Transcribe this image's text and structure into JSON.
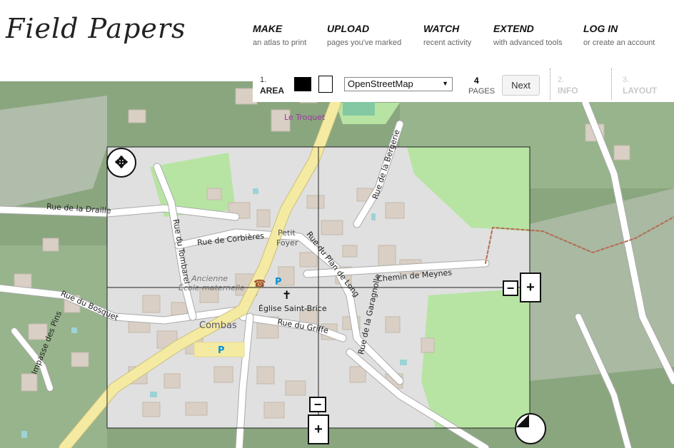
{
  "header": {
    "logo": "Field Papers",
    "nav": [
      {
        "title": "MAKE",
        "sub": "an atlas to print"
      },
      {
        "title": "UPLOAD",
        "sub": "pages you've marked"
      },
      {
        "title": "WATCH",
        "sub": "recent activity"
      },
      {
        "title": "EXTEND",
        "sub": "with advanced tools"
      },
      {
        "title": "LOG IN",
        "sub": "or create an account"
      }
    ]
  },
  "steps": {
    "area": {
      "num": "1.",
      "label": "AREA"
    },
    "provider": "OpenStreetMap",
    "pages_count": "4",
    "pages_label": "PAGES",
    "next_label": "Next",
    "info": {
      "num": "2.",
      "label": "INFO"
    },
    "layout": {
      "num": "3.",
      "label": "LAYOUT"
    }
  },
  "map": {
    "labels": {
      "troquet": "Le Troquet",
      "draille": "Rue de la Draille",
      "tombarel": "Rue du Tombarel",
      "corbieres": "Rue de Corbières",
      "petit": "Petit",
      "foyer": "Foyer",
      "plan_long": "Rue du Plan de Long",
      "bergerie": "Rue de la Bergerie",
      "meynes": "Chemin de Meynes",
      "ancienne": "Ancienne",
      "ecole": "École maternelle",
      "bosquet": "Rue du Bosquet",
      "pins": "Impasse des Pins",
      "eglise": "Église Saint-Brice",
      "combas": "Combas",
      "griffe": "Rue du Griffe",
      "garagnolle": "Rue de la Garagnolle"
    },
    "icons": [
      "move-icon",
      "minus-icon",
      "plus-icon",
      "resize-icon"
    ],
    "colors": {
      "forest": "#8aa67f",
      "residential": "#e0e0e0",
      "grass": "#b7e4a3",
      "primary_road": "#f5eaa2",
      "road": "#ffffff",
      "building": "#d9cfc4"
    }
  }
}
